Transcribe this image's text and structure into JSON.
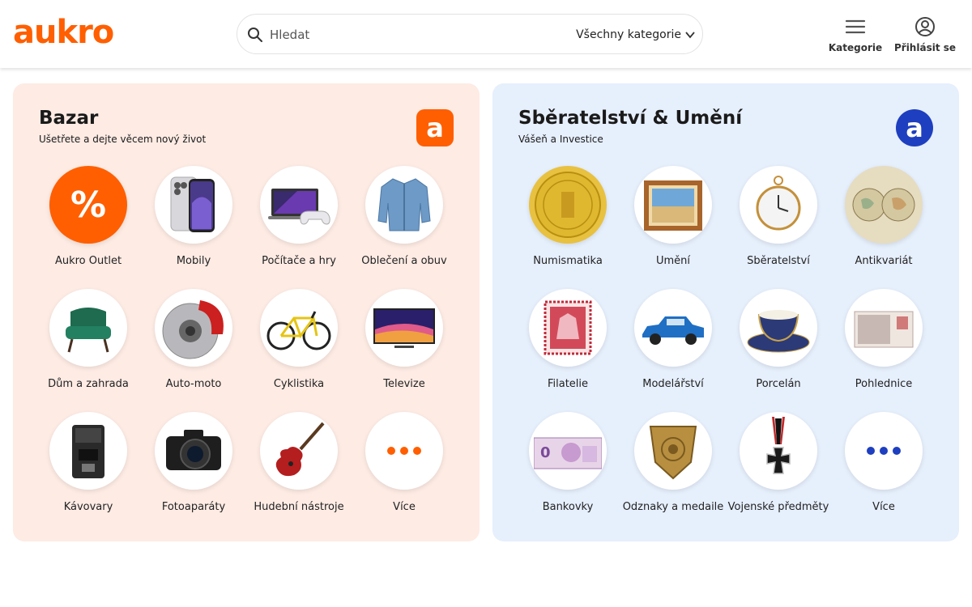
{
  "header": {
    "logo": "aukro",
    "search_placeholder": "Hledat",
    "category_select": "Všechny kategorie",
    "kategorie_label": "Kategorie",
    "login_label": "Přihlásit se"
  },
  "bazar": {
    "title": "Bazar",
    "subtitle": "Ušetřete a dejte věcem nový život",
    "badge": "a",
    "accent": "#ff5f00",
    "items": [
      {
        "label": "Aukro Outlet",
        "icon": "percent-icon",
        "symbol": "%"
      },
      {
        "label": "Mobily",
        "icon": "smartphone-icon"
      },
      {
        "label": "Počítače a hry",
        "icon": "laptop-gamepad-icon"
      },
      {
        "label": "Oblečení a obuv",
        "icon": "denim-jacket-icon"
      },
      {
        "label": "Dům a zahrada",
        "icon": "armchair-icon"
      },
      {
        "label": "Auto-moto",
        "icon": "brake-disc-icon"
      },
      {
        "label": "Cyklistika",
        "icon": "bicycle-icon"
      },
      {
        "label": "Televize",
        "icon": "television-icon"
      },
      {
        "label": "Kávovary",
        "icon": "coffee-machine-icon"
      },
      {
        "label": "Fotoaparáty",
        "icon": "camera-icon"
      },
      {
        "label": "Hudební nástroje",
        "icon": "electric-guitar-icon"
      },
      {
        "label": "Více",
        "icon": "more-dots-icon"
      }
    ]
  },
  "sber": {
    "title": "Sběratelství & Umění",
    "subtitle": "Vášeň a Investice",
    "badge": "a",
    "accent": "#1e3fbf",
    "items": [
      {
        "label": "Numismatika",
        "icon": "gold-coin-icon"
      },
      {
        "label": "Umění",
        "icon": "framed-painting-icon"
      },
      {
        "label": "Sběratelství",
        "icon": "pocket-watch-icon"
      },
      {
        "label": "Antikvariát",
        "icon": "old-map-icon"
      },
      {
        "label": "Filatelie",
        "icon": "postage-stamp-icon"
      },
      {
        "label": "Modelářství",
        "icon": "model-car-icon"
      },
      {
        "label": "Porcelán",
        "icon": "porcelain-cup-icon"
      },
      {
        "label": "Pohlednice",
        "icon": "postcard-icon"
      },
      {
        "label": "Bankovky",
        "icon": "banknote-icon"
      },
      {
        "label": "Odznaky a medaile",
        "icon": "badge-medal-icon"
      },
      {
        "label": "Vojenské předměty",
        "icon": "iron-cross-icon"
      },
      {
        "label": "Více",
        "icon": "more-dots-icon"
      }
    ]
  }
}
